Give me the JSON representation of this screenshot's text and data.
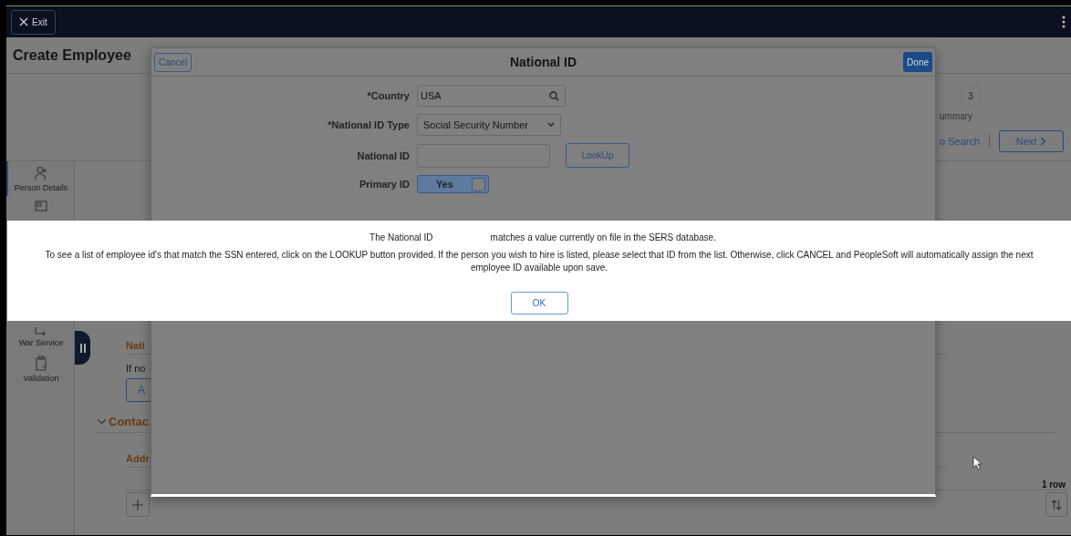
{
  "top_bar": {
    "exit_label": "Exit"
  },
  "page": {
    "title": "Create Employee"
  },
  "stepper": {
    "step_number": "3",
    "step_label": "ummary",
    "back_link": "o Search",
    "next_button": "Next"
  },
  "sidebar": {
    "items": [
      {
        "kind": "person",
        "label": "Person Details",
        "selected": true
      },
      {
        "kind": "card",
        "selected": false
      },
      {
        "kind": "service",
        "label": "War Service",
        "selected": false
      },
      {
        "kind": "validation",
        "label": "Validation",
        "selected": false
      }
    ]
  },
  "content": {
    "section_title": "Nati",
    "body_text": "If no",
    "add_button": "A",
    "contact_heading": "Contac",
    "address_heading": "Addr",
    "row_count": "1 row"
  },
  "modal": {
    "cancel": "Cancel",
    "title": "National ID",
    "done": "Done",
    "fields": [
      {
        "kind": "search",
        "label": "*Country",
        "value": "USA"
      },
      {
        "kind": "select",
        "label": "*National ID Type",
        "value": "Social Security Number"
      },
      {
        "kind": "text",
        "label": "National ID",
        "button": "LookUp"
      },
      {
        "kind": "toggle",
        "label": "Primary ID",
        "value": "Yes",
        "on": true
      }
    ]
  },
  "alert": {
    "line_start": "The National ID",
    "line_end": "matches a value currently on file in the SERS database.",
    "message": "To see a list of employee id's that match the SSN entered, click on the LOOKUP button provided. If the person you wish to hire is listed, please select that ID from the list.   Otherwise, click CANCEL and PeopleSoft will automatically assign the next employee ID available upon save.",
    "ok": "OK"
  }
}
